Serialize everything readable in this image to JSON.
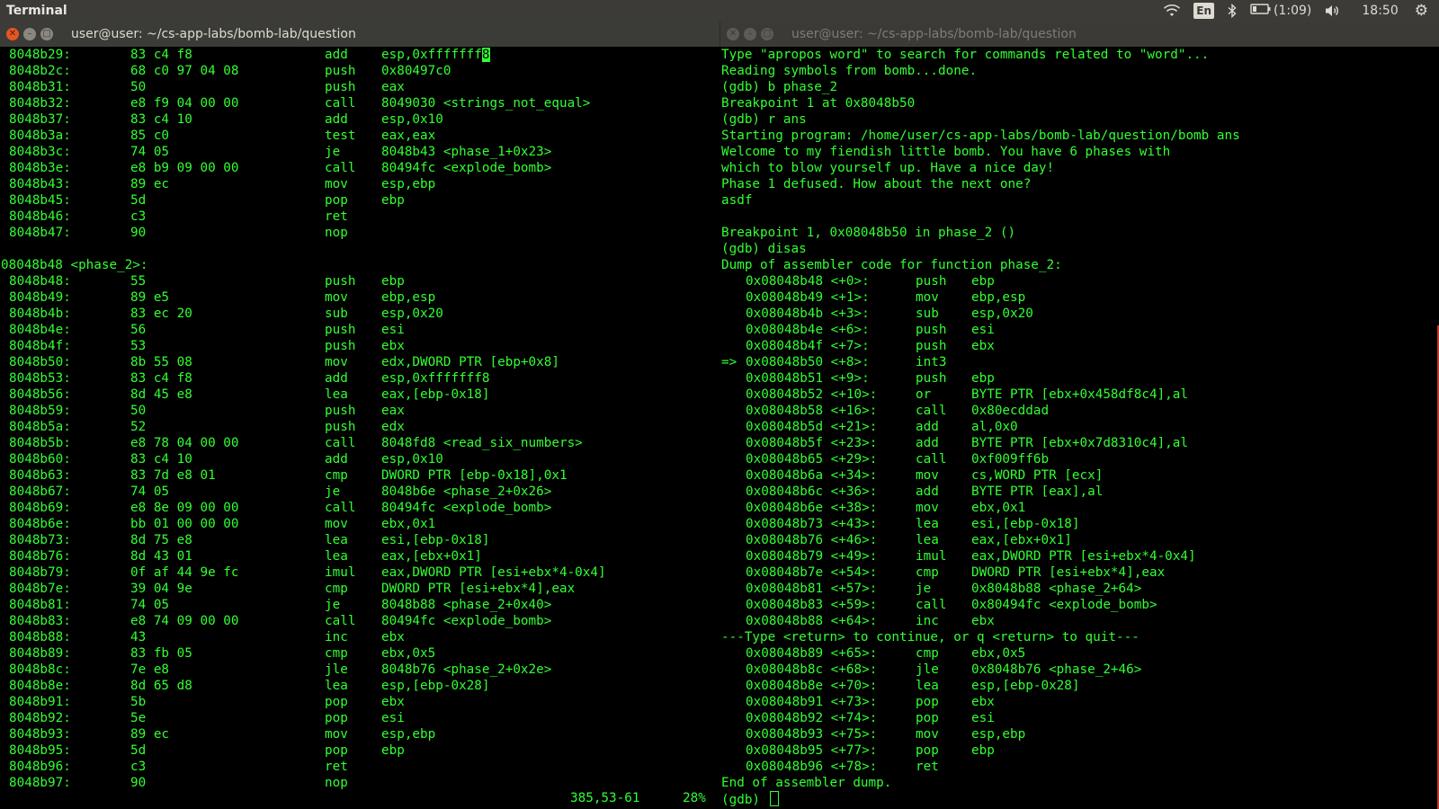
{
  "topbar": {
    "app_title": "Terminal",
    "lang": "En",
    "battery": "(1:09)",
    "time": "18:50"
  },
  "left_window": {
    "title": "user@user: ~/cs-app-labs/bomb-lab/question",
    "cursor_line": 0,
    "cursor_char": "8",
    "lines": [
      {
        "addr": "8048b29:",
        "bytes": "83 c4 f8",
        "mn": "add",
        "op": "esp,0xfffffff"
      },
      {
        "addr": "8048b2c:",
        "bytes": "68 c0 97 04 08",
        "mn": "push",
        "op": "0x80497c0"
      },
      {
        "addr": "8048b31:",
        "bytes": "50",
        "mn": "push",
        "op": "eax"
      },
      {
        "addr": "8048b32:",
        "bytes": "e8 f9 04 00 00",
        "mn": "call",
        "op": "8049030 <strings_not_equal>"
      },
      {
        "addr": "8048b37:",
        "bytes": "83 c4 10",
        "mn": "add",
        "op": "esp,0x10"
      },
      {
        "addr": "8048b3a:",
        "bytes": "85 c0",
        "mn": "test",
        "op": "eax,eax"
      },
      {
        "addr": "8048b3c:",
        "bytes": "74 05",
        "mn": "je",
        "op": "8048b43 <phase_1+0x23>"
      },
      {
        "addr": "8048b3e:",
        "bytes": "e8 b9 09 00 00",
        "mn": "call",
        "op": "80494fc <explode_bomb>"
      },
      {
        "addr": "8048b43:",
        "bytes": "89 ec",
        "mn": "mov",
        "op": "esp,ebp"
      },
      {
        "addr": "8048b45:",
        "bytes": "5d",
        "mn": "pop",
        "op": "ebp"
      },
      {
        "addr": "8048b46:",
        "bytes": "c3",
        "mn": "ret",
        "op": ""
      },
      {
        "addr": "8048b47:",
        "bytes": "90",
        "mn": "nop",
        "op": ""
      },
      {
        "blank": true
      },
      {
        "label": "08048b48 <phase_2>:"
      },
      {
        "addr": "8048b48:",
        "bytes": "55",
        "mn": "push",
        "op": "ebp"
      },
      {
        "addr": "8048b49:",
        "bytes": "89 e5",
        "mn": "mov",
        "op": "ebp,esp"
      },
      {
        "addr": "8048b4b:",
        "bytes": "83 ec 20",
        "mn": "sub",
        "op": "esp,0x20"
      },
      {
        "addr": "8048b4e:",
        "bytes": "56",
        "mn": "push",
        "op": "esi"
      },
      {
        "addr": "8048b4f:",
        "bytes": "53",
        "mn": "push",
        "op": "ebx"
      },
      {
        "addr": "8048b50:",
        "bytes": "8b 55 08",
        "mn": "mov",
        "op": "edx,DWORD PTR [ebp+0x8]"
      },
      {
        "addr": "8048b53:",
        "bytes": "83 c4 f8",
        "mn": "add",
        "op": "esp,0xfffffff8"
      },
      {
        "addr": "8048b56:",
        "bytes": "8d 45 e8",
        "mn": "lea",
        "op": "eax,[ebp-0x18]"
      },
      {
        "addr": "8048b59:",
        "bytes": "50",
        "mn": "push",
        "op": "eax"
      },
      {
        "addr": "8048b5a:",
        "bytes": "52",
        "mn": "push",
        "op": "edx"
      },
      {
        "addr": "8048b5b:",
        "bytes": "e8 78 04 00 00",
        "mn": "call",
        "op": "8048fd8 <read_six_numbers>"
      },
      {
        "addr": "8048b60:",
        "bytes": "83 c4 10",
        "mn": "add",
        "op": "esp,0x10"
      },
      {
        "addr": "8048b63:",
        "bytes": "83 7d e8 01",
        "mn": "cmp",
        "op": "DWORD PTR [ebp-0x18],0x1"
      },
      {
        "addr": "8048b67:",
        "bytes": "74 05",
        "mn": "je",
        "op": "8048b6e <phase_2+0x26>"
      },
      {
        "addr": "8048b69:",
        "bytes": "e8 8e 09 00 00",
        "mn": "call",
        "op": "80494fc <explode_bomb>"
      },
      {
        "addr": "8048b6e:",
        "bytes": "bb 01 00 00 00",
        "mn": "mov",
        "op": "ebx,0x1"
      },
      {
        "addr": "8048b73:",
        "bytes": "8d 75 e8",
        "mn": "lea",
        "op": "esi,[ebp-0x18]"
      },
      {
        "addr": "8048b76:",
        "bytes": "8d 43 01",
        "mn": "lea",
        "op": "eax,[ebx+0x1]"
      },
      {
        "addr": "8048b79:",
        "bytes": "0f af 44 9e fc",
        "mn": "imul",
        "op": "eax,DWORD PTR [esi+ebx*4-0x4]"
      },
      {
        "addr": "8048b7e:",
        "bytes": "39 04 9e",
        "mn": "cmp",
        "op": "DWORD PTR [esi+ebx*4],eax"
      },
      {
        "addr": "8048b81:",
        "bytes": "74 05",
        "mn": "je",
        "op": "8048b88 <phase_2+0x40>"
      },
      {
        "addr": "8048b83:",
        "bytes": "e8 74 09 00 00",
        "mn": "call",
        "op": "80494fc <explode_bomb>"
      },
      {
        "addr": "8048b88:",
        "bytes": "43",
        "mn": "inc",
        "op": "ebx"
      },
      {
        "addr": "8048b89:",
        "bytes": "83 fb 05",
        "mn": "cmp",
        "op": "ebx,0x5"
      },
      {
        "addr": "8048b8c:",
        "bytes": "7e e8",
        "mn": "jle",
        "op": "8048b76 <phase_2+0x2e>"
      },
      {
        "addr": "8048b8e:",
        "bytes": "8d 65 d8",
        "mn": "lea",
        "op": "esp,[ebp-0x28]"
      },
      {
        "addr": "8048b91:",
        "bytes": "5b",
        "mn": "pop",
        "op": "ebx"
      },
      {
        "addr": "8048b92:",
        "bytes": "5e",
        "mn": "pop",
        "op": "esi"
      },
      {
        "addr": "8048b93:",
        "bytes": "89 ec",
        "mn": "mov",
        "op": "esp,ebp"
      },
      {
        "addr": "8048b95:",
        "bytes": "5d",
        "mn": "pop",
        "op": "ebp"
      },
      {
        "addr": "8048b96:",
        "bytes": "c3",
        "mn": "ret",
        "op": ""
      },
      {
        "addr": "8048b97:",
        "bytes": "90",
        "mn": "nop",
        "op": ""
      }
    ],
    "status_position": "385,53-61",
    "status_percent": "28%"
  },
  "right_window": {
    "title": "user@user: ~/cs-app-labs/bomb-lab/question",
    "lines": [
      {
        "text": "Type \"apropos word\" to search for commands related to \"word\"..."
      },
      {
        "text": "Reading symbols from bomb...done."
      },
      {
        "text": "(gdb) b phase_2"
      },
      {
        "text": "Breakpoint 1 at 0x8048b50"
      },
      {
        "text": "(gdb) r ans"
      },
      {
        "text": "Starting program: /home/user/cs-app-labs/bomb-lab/question/bomb ans"
      },
      {
        "text": "Welcome to my fiendish little bomb. You have 6 phases with"
      },
      {
        "text": "which to blow yourself up. Have a nice day!"
      },
      {
        "text": "Phase 1 defused. How about the next one?"
      },
      {
        "text": "asdf"
      },
      {
        "text": ""
      },
      {
        "text": "Breakpoint 1, 0x08048b50 in phase_2 ()"
      },
      {
        "text": "(gdb) disas"
      },
      {
        "text": "Dump of assembler code for function phase_2:"
      },
      {
        "addr": "0x08048b48 <+0>:",
        "mn": "push",
        "op": "ebp"
      },
      {
        "addr": "0x08048b49 <+1>:",
        "mn": "mov",
        "op": "ebp,esp"
      },
      {
        "addr": "0x08048b4b <+3>:",
        "mn": "sub",
        "op": "esp,0x20"
      },
      {
        "addr": "0x08048b4e <+6>:",
        "mn": "push",
        "op": "esi"
      },
      {
        "addr": "0x08048b4f <+7>:",
        "mn": "push",
        "op": "ebx"
      },
      {
        "arrow": "=>",
        "addr": "0x08048b50 <+8>:",
        "mn": "int3",
        "op": ""
      },
      {
        "addr": "0x08048b51 <+9>:",
        "mn": "push",
        "op": "ebp"
      },
      {
        "addr": "0x08048b52 <+10>:",
        "mn": "or",
        "op": "BYTE PTR [ebx+0x458df8c4],al"
      },
      {
        "addr": "0x08048b58 <+16>:",
        "mn": "call",
        "op": "0x80ecddad"
      },
      {
        "addr": "0x08048b5d <+21>:",
        "mn": "add",
        "op": "al,0x0"
      },
      {
        "addr": "0x08048b5f <+23>:",
        "mn": "add",
        "op": "BYTE PTR [ebx+0x7d8310c4],al"
      },
      {
        "addr": "0x08048b65 <+29>:",
        "mn": "call",
        "op": "0xf009ff6b"
      },
      {
        "addr": "0x08048b6a <+34>:",
        "mn": "mov",
        "op": "cs,WORD PTR [ecx]"
      },
      {
        "addr": "0x08048b6c <+36>:",
        "mn": "add",
        "op": "BYTE PTR [eax],al"
      },
      {
        "addr": "0x08048b6e <+38>:",
        "mn": "mov",
        "op": "ebx,0x1"
      },
      {
        "addr": "0x08048b73 <+43>:",
        "mn": "lea",
        "op": "esi,[ebp-0x18]"
      },
      {
        "addr": "0x08048b76 <+46>:",
        "mn": "lea",
        "op": "eax,[ebx+0x1]"
      },
      {
        "addr": "0x08048b79 <+49>:",
        "mn": "imul",
        "op": "eax,DWORD PTR [esi+ebx*4-0x4]"
      },
      {
        "addr": "0x08048b7e <+54>:",
        "mn": "cmp",
        "op": "DWORD PTR [esi+ebx*4],eax"
      },
      {
        "addr": "0x08048b81 <+57>:",
        "mn": "je",
        "op": "0x8048b88 <phase_2+64>"
      },
      {
        "addr": "0x08048b83 <+59>:",
        "mn": "call",
        "op": "0x80494fc <explode_bomb>"
      },
      {
        "addr": "0x08048b88 <+64>:",
        "mn": "inc",
        "op": "ebx"
      },
      {
        "text": "---Type <return> to continue, or q <return> to quit---"
      },
      {
        "addr": "0x08048b89 <+65>:",
        "mn": "cmp",
        "op": "ebx,0x5"
      },
      {
        "addr": "0x08048b8c <+68>:",
        "mn": "jle",
        "op": "0x8048b76 <phase_2+46>"
      },
      {
        "addr": "0x08048b8e <+70>:",
        "mn": "lea",
        "op": "esp,[ebp-0x28]"
      },
      {
        "addr": "0x08048b91 <+73>:",
        "mn": "pop",
        "op": "ebx"
      },
      {
        "addr": "0x08048b92 <+74>:",
        "mn": "pop",
        "op": "esi"
      },
      {
        "addr": "0x08048b93 <+75>:",
        "mn": "mov",
        "op": "esp,ebp"
      },
      {
        "addr": "0x08048b95 <+77>:",
        "mn": "pop",
        "op": "ebp"
      },
      {
        "addr": "0x08048b96 <+78>:",
        "mn": "ret",
        "op": ""
      },
      {
        "text": "End of assembler dump."
      },
      {
        "prompt": "(gdb) "
      }
    ]
  },
  "colors": {
    "terminal_fg": "#32ff32",
    "terminal_bg": "#000000",
    "panel_bg": "#3c3b37",
    "close_button": "#e95420"
  },
  "icons": [
    "wifi-icon",
    "keyboard-language-icon",
    "bluetooth-icon",
    "battery-icon",
    "volume-icon",
    "gear-icon",
    "close-icon",
    "minimize-icon",
    "maximize-icon"
  ]
}
